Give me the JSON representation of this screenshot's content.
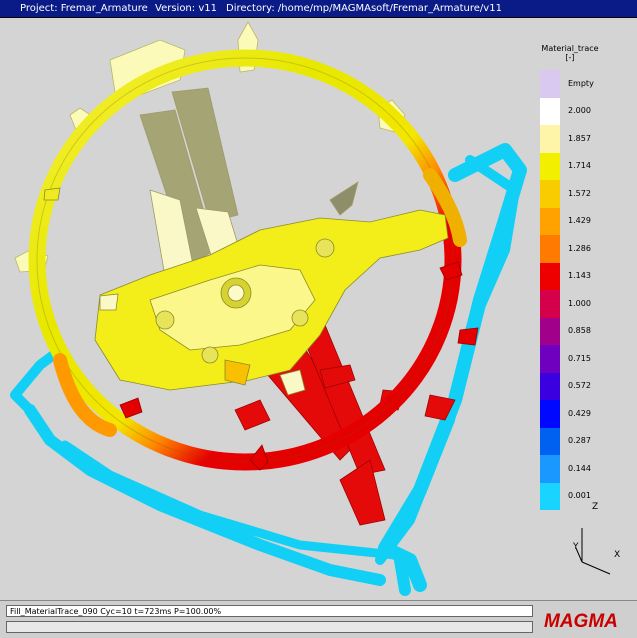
{
  "titlebar": {
    "project": "Project: Fremar_Armature",
    "version": "Version: v11",
    "directory": "Directory: /home/mp/MAGMAsoft/Fremar_Armature/v11"
  },
  "legend": {
    "title": "Material_trace",
    "unit": "[-]",
    "entries": [
      {
        "label": "Empty",
        "color": "#d9c8f0"
      },
      {
        "label": "2.000",
        "color": "#ffffff"
      },
      {
        "label": "1.857",
        "color": "#fff5a8"
      },
      {
        "label": "1.714",
        "color": "#f2f000"
      },
      {
        "label": "1.572",
        "color": "#f9cc00"
      },
      {
        "label": "1.429",
        "color": "#ffa200"
      },
      {
        "label": "1.286",
        "color": "#ff7a00"
      },
      {
        "label": "1.143",
        "color": "#ee0000"
      },
      {
        "label": "1.000",
        "color": "#d4004c"
      },
      {
        "label": "0.858",
        "color": "#a0008a"
      },
      {
        "label": "0.715",
        "color": "#7000c0"
      },
      {
        "label": "0.572",
        "color": "#3a00e0"
      },
      {
        "label": "0.429",
        "color": "#0008ff"
      },
      {
        "label": "0.287",
        "color": "#0060f0"
      },
      {
        "label": "0.144",
        "color": "#1a98ff"
      },
      {
        "label": "0.001",
        "color": "#18d4ff"
      }
    ]
  },
  "axes": {
    "z": "Z",
    "y": "Y",
    "x": "X"
  },
  "status": {
    "text": "Fill_MaterialTrace_090  Cyc=10  t=723ms  P=100.00%",
    "progress_percent": 100
  },
  "logo": {
    "text": "MAGMA"
  }
}
